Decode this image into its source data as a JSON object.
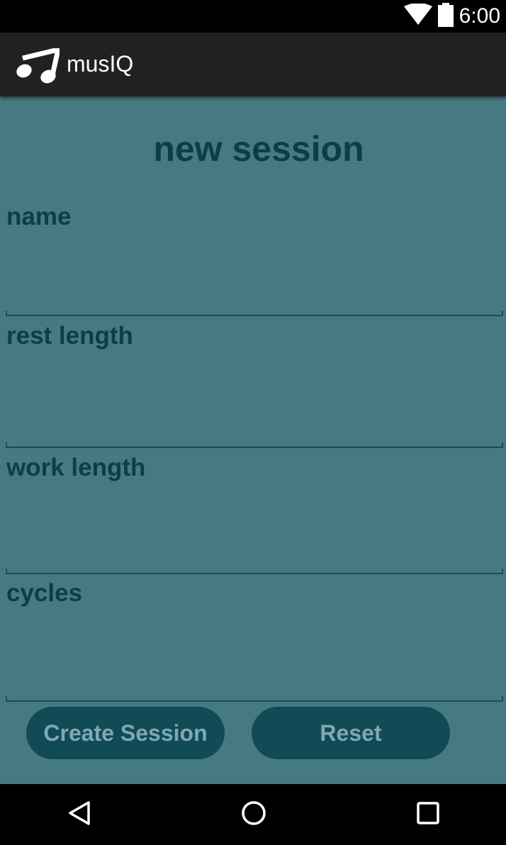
{
  "status_bar": {
    "time": "6:00"
  },
  "app_bar": {
    "title": "musIQ"
  },
  "form": {
    "title": "new session",
    "fields": [
      {
        "label": "name",
        "value": ""
      },
      {
        "label": "rest length",
        "value": ""
      },
      {
        "label": "work length",
        "value": ""
      },
      {
        "label": "cycles",
        "value": ""
      }
    ],
    "create_button": "Create Session",
    "reset_button": "Reset"
  },
  "icons": {
    "status": [
      "wifi-icon",
      "battery-icon"
    ],
    "app": "music-note-logo-icon",
    "nav": [
      "back-icon",
      "home-icon",
      "recents-icon"
    ]
  },
  "colors": {
    "background": "#457a82",
    "accent": "#124a55",
    "text": "#0e3c48",
    "app_bar": "#212121"
  }
}
